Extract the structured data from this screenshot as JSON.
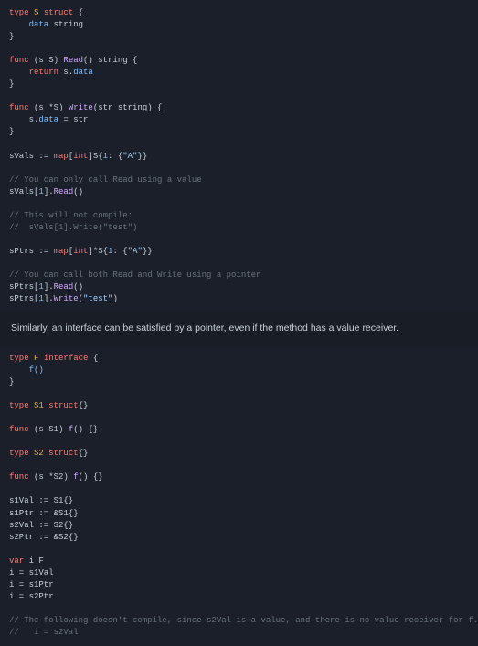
{
  "code1": {
    "l1_type": "type",
    "l1_S": "S",
    "l1_struct": "struct",
    "l1_brace": " {",
    "l2_data": "    data",
    "l2_string": " string",
    "l3_close": "}",
    "l4": "",
    "l5_func": "func",
    "l5_recv": " (s S) ",
    "l5_Read": "Read",
    "l5_sig": "() string {",
    "l6_return": "    return",
    "l6_expr": " s.",
    "l6_data": "data",
    "l7_close": "}",
    "l8": "",
    "l9_func": "func",
    "l9_recv": " (s *S) ",
    "l9_Write": "Write",
    "l9_sig": "(str string) {",
    "l10_lhs": "    s.",
    "l10_data": "data",
    "l10_rhs": " = str",
    "l11_close": "}",
    "l12": "",
    "l13_lhs": "sVals := ",
    "l13_map": "map",
    "l13_key": "[",
    "l13_int": "int",
    "l13_rest": "]S{",
    "l13_n": "1",
    "l13_mid": ": {",
    "l13_str": "\"A\"",
    "l13_end": "}}",
    "l14": "",
    "l15_cmt": "// You can only call Read using a value",
    "l16_lhs": "sVals[",
    "l16_n": "1",
    "l16_mid": "].",
    "l16_Read": "Read",
    "l16_end": "()",
    "l17": "",
    "l18_cmt": "// This will not compile:",
    "l19_cmt": "//  sVals[1].Write(\"test\")",
    "l20": "",
    "l21_lhs": "sPtrs := ",
    "l21_map": "map",
    "l21_key": "[",
    "l21_int": "int",
    "l21_rest": "]*S{",
    "l21_n": "1",
    "l21_mid": ": {",
    "l21_str": "\"A\"",
    "l21_end": "}}",
    "l22": "",
    "l23_cmt": "// You can call both Read and Write using a pointer",
    "l24_lhs": "sPtrs[",
    "l24_n": "1",
    "l24_mid": "].",
    "l24_Read": "Read",
    "l24_end": "()",
    "l25_lhs": "sPtrs[",
    "l25_n": "1",
    "l25_mid": "].",
    "l25_Write": "Write",
    "l25_arg": "(",
    "l25_str": "\"test\"",
    "l25_end": ")"
  },
  "prose1": "Similarly, an interface can be satisfied by a pointer, even if the method has a value receiver.",
  "code2": {
    "l1_type": "type",
    "l1_F": " F ",
    "l1_interface": "interface",
    "l1_brace": " {",
    "l2_f": "    f()",
    "l3_close": "}",
    "l4": "",
    "l5_type": "type",
    "l5_S1": " S1 ",
    "l5_struct": "struct",
    "l5_brace": "{}",
    "l6": "",
    "l7_func": "func",
    "l7_recv": " (s S1) ",
    "l7_f": "f",
    "l7_sig": "() {}",
    "l8": "",
    "l9_type": "type",
    "l9_S2": " S2 ",
    "l9_struct": "struct",
    "l9_brace": "{}",
    "l10": "",
    "l11_func": "func",
    "l11_recv": " (s *S2) ",
    "l11_f": "f",
    "l11_sig": "() {}",
    "l12": "",
    "l13_a": "s1Val := S1{}",
    "l14_a": "s1Ptr := &S1{}",
    "l15_a": "s2Val := S2{}",
    "l16_a": "s2Ptr := &S2{}",
    "l17": "",
    "l18_var": "var",
    "l18_rest": " i F",
    "l19": "i = s1Val",
    "l20": "i = s1Ptr",
    "l21": "i = s2Ptr",
    "l22": "",
    "l23_cmt": "// The following doesn't compile, since s2Val is a value, and there is no value receiver for f.",
    "l24_cmt": "//   i = s2Val"
  }
}
